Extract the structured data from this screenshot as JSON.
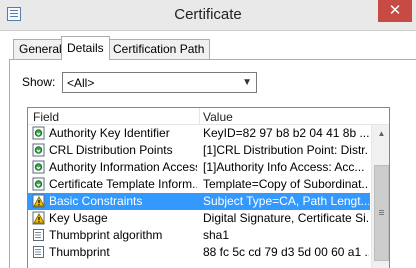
{
  "window": {
    "title": "Certificate",
    "close_glyph": "✕"
  },
  "tabs": [
    {
      "label": "General"
    },
    {
      "label": "Details"
    },
    {
      "label": "Certification Path"
    }
  ],
  "show": {
    "label": "Show:",
    "selected": "<All>"
  },
  "table": {
    "columns": [
      "Field",
      "Value"
    ],
    "rows": [
      {
        "icon": "cert-extension-icon",
        "field": "Authority Key Identifier",
        "value": "KeyID=82 97 b8 b2 04 41 8b ..."
      },
      {
        "icon": "cert-extension-icon",
        "field": "CRL Distribution Points",
        "value": "[1]CRL Distribution Point: Distr..."
      },
      {
        "icon": "cert-extension-icon",
        "field": "Authority Information Access",
        "value": "[1]Authority Info Access: Acc..."
      },
      {
        "icon": "cert-extension-icon",
        "field": "Certificate Template Inform...",
        "value": "Template=Copy of Subordinat..."
      },
      {
        "icon": "cert-critical-extension-icon",
        "field": "Basic Constraints",
        "value": "Subject Type=CA, Path Lengt...",
        "selected": true
      },
      {
        "icon": "cert-critical-extension-icon",
        "field": "Key Usage",
        "value": "Digital Signature, Certificate Si..."
      },
      {
        "icon": "cert-property-icon",
        "field": "Thumbprint algorithm",
        "value": "sha1"
      },
      {
        "icon": "cert-property-icon",
        "field": "Thumbprint",
        "value": "88 fc 5c cd 79 d3 5d 00 60 a1 ..."
      }
    ]
  },
  "colors": {
    "selection": "#3399ff",
    "close_button": "#c74b43"
  }
}
